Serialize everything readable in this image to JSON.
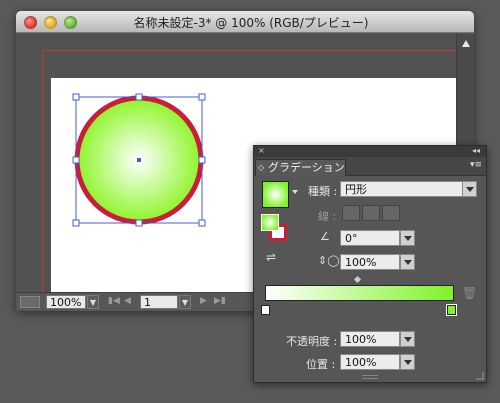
{
  "window": {
    "title": "名称未設定-3* @ 100% (RGB/プレビュー)"
  },
  "status_bar": {
    "zoom": "100%",
    "page": "1"
  },
  "gradient_panel": {
    "close_glyph": "×",
    "collapse_glyph": "◂◂",
    "tab_label": "グラデーション",
    "tab_prefix": "◇",
    "menu_glyph": "▾≡",
    "type_label": "種類 :",
    "type_value": "円形",
    "stroke_label": "線 :",
    "angle_value": "0°",
    "aspect_value": "100%",
    "opacity_label": "不透明度 :",
    "opacity_value": "100%",
    "location_label": "位置 :",
    "location_value": "100%",
    "gradient_start_color": "#ffffff",
    "gradient_end_color": "#80f22a"
  },
  "colors": {
    "circle_fill_center": "#ffffff",
    "circle_fill_edge": "#8ef52a",
    "circle_stroke": "#c91d3a",
    "selection_color": "#4a5bd6",
    "artboard_border": "#c83434"
  }
}
